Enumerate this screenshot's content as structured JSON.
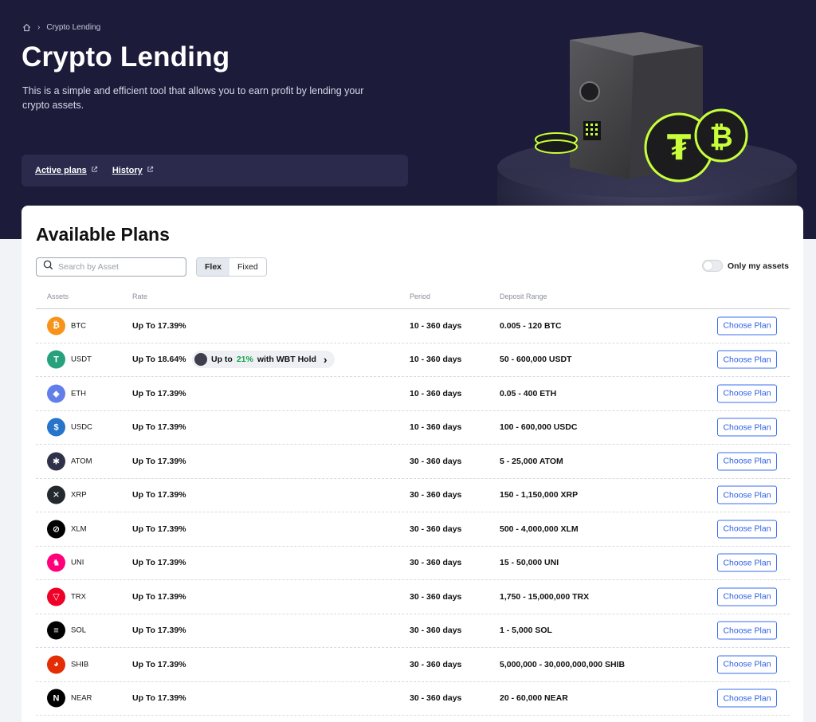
{
  "breadcrumb": {
    "current": "Crypto Lending"
  },
  "hero": {
    "title": "Crypto Lending",
    "description": "This is a simple and efficient tool that allows you to earn profit by lending your crypto assets.",
    "links": [
      "Active plans",
      "History"
    ]
  },
  "plans": {
    "title": "Available Plans",
    "search_placeholder": "Search by Asset",
    "tabs": [
      "Flex",
      "Fixed"
    ],
    "active_tab": "Flex",
    "toggle_label": "Only my assets",
    "columns": [
      "Assets",
      "Rate",
      "Period",
      "Deposit Range"
    ],
    "button_label": "Choose Plan",
    "promo": {
      "prefix": "Up to",
      "percent": "21%",
      "suffix": "with WBT Hold",
      "chevron": "›"
    },
    "rows": [
      {
        "symbol": "BTC",
        "rate": "Up To 17.39%",
        "period": "10 - 360 days",
        "range": "0.005 - 120 BTC",
        "color": "#f7931a",
        "icon": "bitcoin-icon",
        "glyph": "₿"
      },
      {
        "symbol": "USDT",
        "rate": "Up To 18.64%",
        "period": "10 - 360 days",
        "range": "50 - 600,000 USDT",
        "color": "#26a17b",
        "icon": "tether-icon",
        "glyph": "T"
      },
      {
        "symbol": "ETH",
        "rate": "Up To 17.39%",
        "period": "10 - 360 days",
        "range": "0.05 - 400 ETH",
        "color": "#627eea",
        "icon": "ethereum-icon",
        "glyph": "◆"
      },
      {
        "symbol": "USDC",
        "rate": "Up To 17.39%",
        "period": "10 - 360 days",
        "range": "100 - 600,000 USDC",
        "color": "#2775ca",
        "icon": "usdc-icon",
        "glyph": "$"
      },
      {
        "symbol": "ATOM",
        "rate": "Up To 17.39%",
        "period": "30 - 360 days",
        "range": "5 - 25,000 ATOM",
        "color": "#2e3148",
        "icon": "cosmos-icon",
        "glyph": "✱"
      },
      {
        "symbol": "XRP",
        "rate": "Up To 17.39%",
        "period": "30 - 360 days",
        "range": "150 - 1,150,000 XRP",
        "color": "#23292f",
        "icon": "xrp-icon",
        "glyph": "✕"
      },
      {
        "symbol": "XLM",
        "rate": "Up To 17.39%",
        "period": "30 - 360 days",
        "range": "500 - 4,000,000 XLM",
        "color": "#000000",
        "icon": "stellar-icon",
        "glyph": "⊘"
      },
      {
        "symbol": "UNI",
        "rate": "Up To 17.39%",
        "period": "30 - 360 days",
        "range": "15 - 50,000 UNI",
        "color": "#ff007a",
        "icon": "uniswap-icon",
        "glyph": "♞"
      },
      {
        "symbol": "TRX",
        "rate": "Up To 17.39%",
        "period": "30 - 360 days",
        "range": "1,750 - 15,000,000 TRX",
        "color": "#ef0027",
        "icon": "tron-icon",
        "glyph": "▽"
      },
      {
        "symbol": "SOL",
        "rate": "Up To 17.39%",
        "period": "30 - 360 days",
        "range": "1 - 5,000 SOL",
        "color": "#000000",
        "icon": "solana-icon",
        "glyph": "≡"
      },
      {
        "symbol": "SHIB",
        "rate": "Up To 17.39%",
        "period": "30 - 360 days",
        "range": "5,000,000 - 30,000,000,000 SHIB",
        "color": "#e42d04",
        "icon": "shiba-icon",
        "glyph": "◕"
      },
      {
        "symbol": "NEAR",
        "rate": "Up To 17.39%",
        "period": "30 - 360 days",
        "range": "20 - 60,000 NEAR",
        "color": "#000000",
        "icon": "near-icon",
        "glyph": "N"
      }
    ]
  },
  "colors": {
    "hero_bg": "#1c1b3a",
    "accent": "#2c5fe6",
    "promo_green": "#16a34a"
  }
}
